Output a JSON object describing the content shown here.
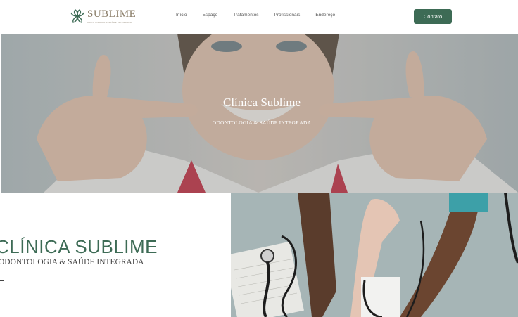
{
  "brand": {
    "name": "SUBLIME",
    "tagline": "ODONTOLOGIA & SAÚDE INTEGRADA",
    "accent_color": "#3d6b55",
    "logo_color": "#8a7d68"
  },
  "nav": {
    "items": [
      {
        "label": "Início"
      },
      {
        "label": "Espaço"
      },
      {
        "label": "Tratamentos"
      },
      {
        "label": "Profissionais"
      },
      {
        "label": "Endereço"
      }
    ],
    "cta_label": "Contato"
  },
  "hero": {
    "title": "Clínica Sublime",
    "subtitle": "ODONTOLOGIA & SAÚDE INTEGRADA"
  },
  "about": {
    "title": "CLÍNICA SUBLIME",
    "subtitle": "ODONTOLOGIA & SAÚDE INTEGRADA"
  }
}
